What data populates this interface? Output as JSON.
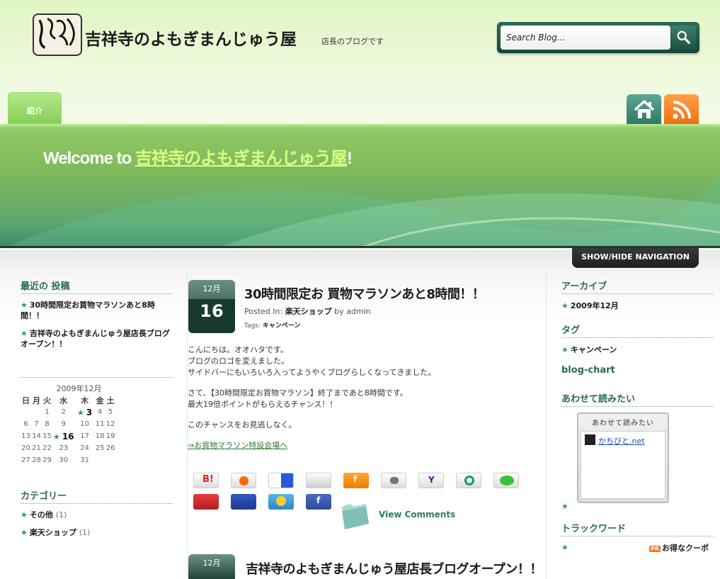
{
  "header": {
    "site_title": "吉祥寺のよもぎまんじゅう屋",
    "tagline": "店長のブログです",
    "search_placeholder": "Search Blog..."
  },
  "nav": {
    "tab_intro": "紹介",
    "toggle_nav": "SHOW/HIDE NAVIGATION"
  },
  "banner": {
    "welcome_prefix": "Welcome to ",
    "welcome_link": "吉祥寺のよもぎまんじゅう屋",
    "welcome_suffix": "!"
  },
  "left": {
    "recent_title": "最近の 投稿",
    "recent_posts": [
      "30時間限定お買物マラソンあと8時間！！",
      "吉祥寺のよもぎまんじゅう屋店長ブログオープン！！"
    ],
    "calendar_caption": "2009年12月",
    "weekdays": [
      "日",
      "月",
      "火",
      "水",
      "木",
      "金",
      "土"
    ],
    "weeks": [
      [
        "",
        "",
        "1",
        "2",
        "3",
        "4",
        "5"
      ],
      [
        "6",
        "7",
        "8",
        "9",
        "10",
        "11",
        "12"
      ],
      [
        "13",
        "14",
        "15",
        "16",
        "17",
        "18",
        "19"
      ],
      [
        "20",
        "21",
        "22",
        "23",
        "24",
        "25",
        "26"
      ],
      [
        "27",
        "28",
        "29",
        "30",
        "31",
        "",
        ""
      ]
    ],
    "categories_title": "カテゴリー",
    "categories": [
      {
        "name": "その他",
        "count": "(1)"
      },
      {
        "name": "楽天ショップ",
        "count": "(1)"
      }
    ]
  },
  "post1": {
    "month": "12月",
    "day": "16",
    "title": "30時間限定お 買物マラソンあと8時間！！",
    "posted_in_label": "Posted In: ",
    "category": "楽天ショップ",
    "by_label": " by ",
    "author": "admin",
    "tags_label": "Tags: ",
    "tag": "キャンペーン",
    "body": [
      "こんにちは。オオハタです。",
      "ブログのロゴを変えました。",
      "サイドバーにもいろいろ入ってようやくブログらしくなってきました。",
      "さて、【30時間限定お買物マラソン】終了まであと8時間です。",
      "最大19倍ポイントがもらえるチャンス！！",
      "このチャンスをお見逃しなく。"
    ],
    "link": "⇒お買物マラソン特設会場へ",
    "view_comments": "View Comments",
    "share_icons": [
      "hatena-icon",
      "livedoor-icon",
      "delicious-icon",
      "buzzurl-icon",
      "fc2-icon",
      "newsing-icon",
      "yahoo-icon",
      "choix-icon",
      "mixi-icon",
      "pookmark-icon",
      "nifty-icon",
      "topy-icon",
      "facebook-icon"
    ]
  },
  "post2": {
    "month": "12月",
    "title": "吉祥寺のよもぎまんじゅう屋店長ブログオープン！！"
  },
  "right": {
    "archive_title": "アーカイブ",
    "archive_item": "2009年12月",
    "tags_title": "タグ",
    "tags_item": "キャンペーン",
    "blog_chart_title": "blog-chart",
    "awasete_title": "あわせて読みたい",
    "awasete_box_head": "あわせて読みたい",
    "awasete_link": "かちびと.net",
    "trackword_title": "トラックワード",
    "pr_badge": "PR",
    "pr_text": "お得なクーポ"
  },
  "colors": {
    "accent": "#2a6a52",
    "banner": "#7fb85a",
    "rss": "#f07010"
  }
}
